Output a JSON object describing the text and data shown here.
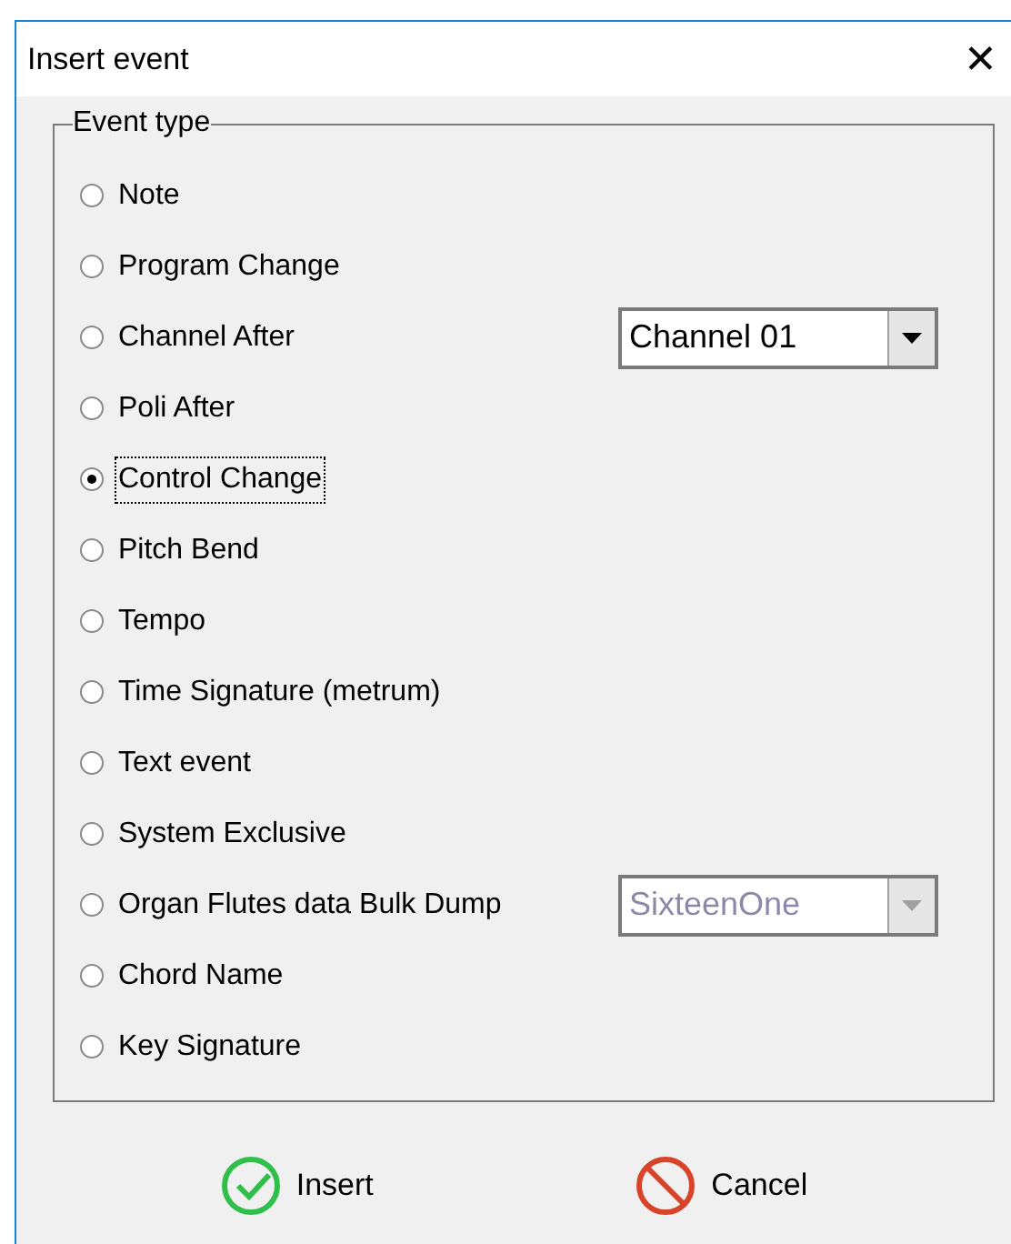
{
  "window": {
    "title": "Insert event",
    "close": "✕"
  },
  "event_type": {
    "legend": "Event type",
    "options": [
      {
        "label": "Note",
        "selected": false
      },
      {
        "label": "Program Change",
        "selected": false
      },
      {
        "label": "Channel After",
        "selected": false,
        "combo": {
          "value": "Channel 01",
          "disabled": false
        }
      },
      {
        "label": "Poli After",
        "selected": false
      },
      {
        "label": "Control Change",
        "selected": true
      },
      {
        "label": "Pitch Bend",
        "selected": false
      },
      {
        "label": "Tempo",
        "selected": false
      },
      {
        "label": "Time Signature (metrum)",
        "selected": false
      },
      {
        "label": "Text event",
        "selected": false
      },
      {
        "label": "System Exclusive",
        "selected": false
      },
      {
        "label": "Organ Flutes data Bulk Dump",
        "selected": false,
        "combo": {
          "value": "SixteenOne",
          "disabled": true
        }
      },
      {
        "label": "Chord Name",
        "selected": false
      },
      {
        "label": "Key Signature",
        "selected": false
      }
    ]
  },
  "buttons": [
    {
      "label": "Insert",
      "kind": "ok"
    },
    {
      "label": "Cancel",
      "kind": "cancel"
    }
  ]
}
